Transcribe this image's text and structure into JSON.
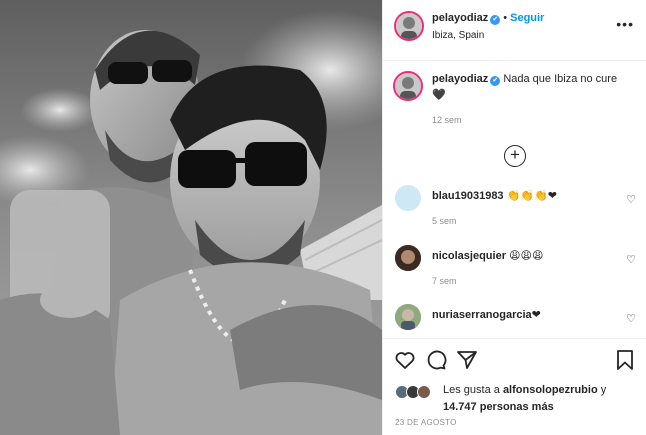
{
  "post": {
    "username": "pelayodiaz",
    "verified_mark": "✔",
    "separator": "•",
    "follow_label": "Seguir",
    "location": "Ibiza, Spain",
    "more_icon": "more-dots-icon"
  },
  "caption": {
    "username": "pelayodiaz",
    "text": "Nada que Ibiza no cure",
    "emoji": "🖤",
    "time": "12 sem"
  },
  "load_more_icon": "plus-circle-icon",
  "comments": [
    {
      "username": "blau19031983",
      "text": "👏👏👏❤",
      "time": "5 sem",
      "avatar_color": "#cfe8f6"
    },
    {
      "username": "nicolasjequier",
      "text": "😩😩😩",
      "time": "7 sem",
      "avatar_color": "#6a4a3a"
    },
    {
      "username": "nuriaserranogarcia",
      "text": "❤",
      "time": "",
      "avatar_color": "#7a9a6a"
    }
  ],
  "likes": {
    "prefix": "Les gusta a",
    "user": "alfonsolopezrubio",
    "joiner": "y",
    "count": "14.747",
    "suffix": "personas más"
  },
  "date": "23 DE AGOSTO",
  "icons": {
    "like": "heart-icon",
    "comment": "comment-icon",
    "share": "share-icon",
    "save": "bookmark-icon"
  },
  "colors": {
    "link": "#0095f6",
    "muted": "#8e8e8e",
    "text": "#262626",
    "border": "#efefef"
  }
}
